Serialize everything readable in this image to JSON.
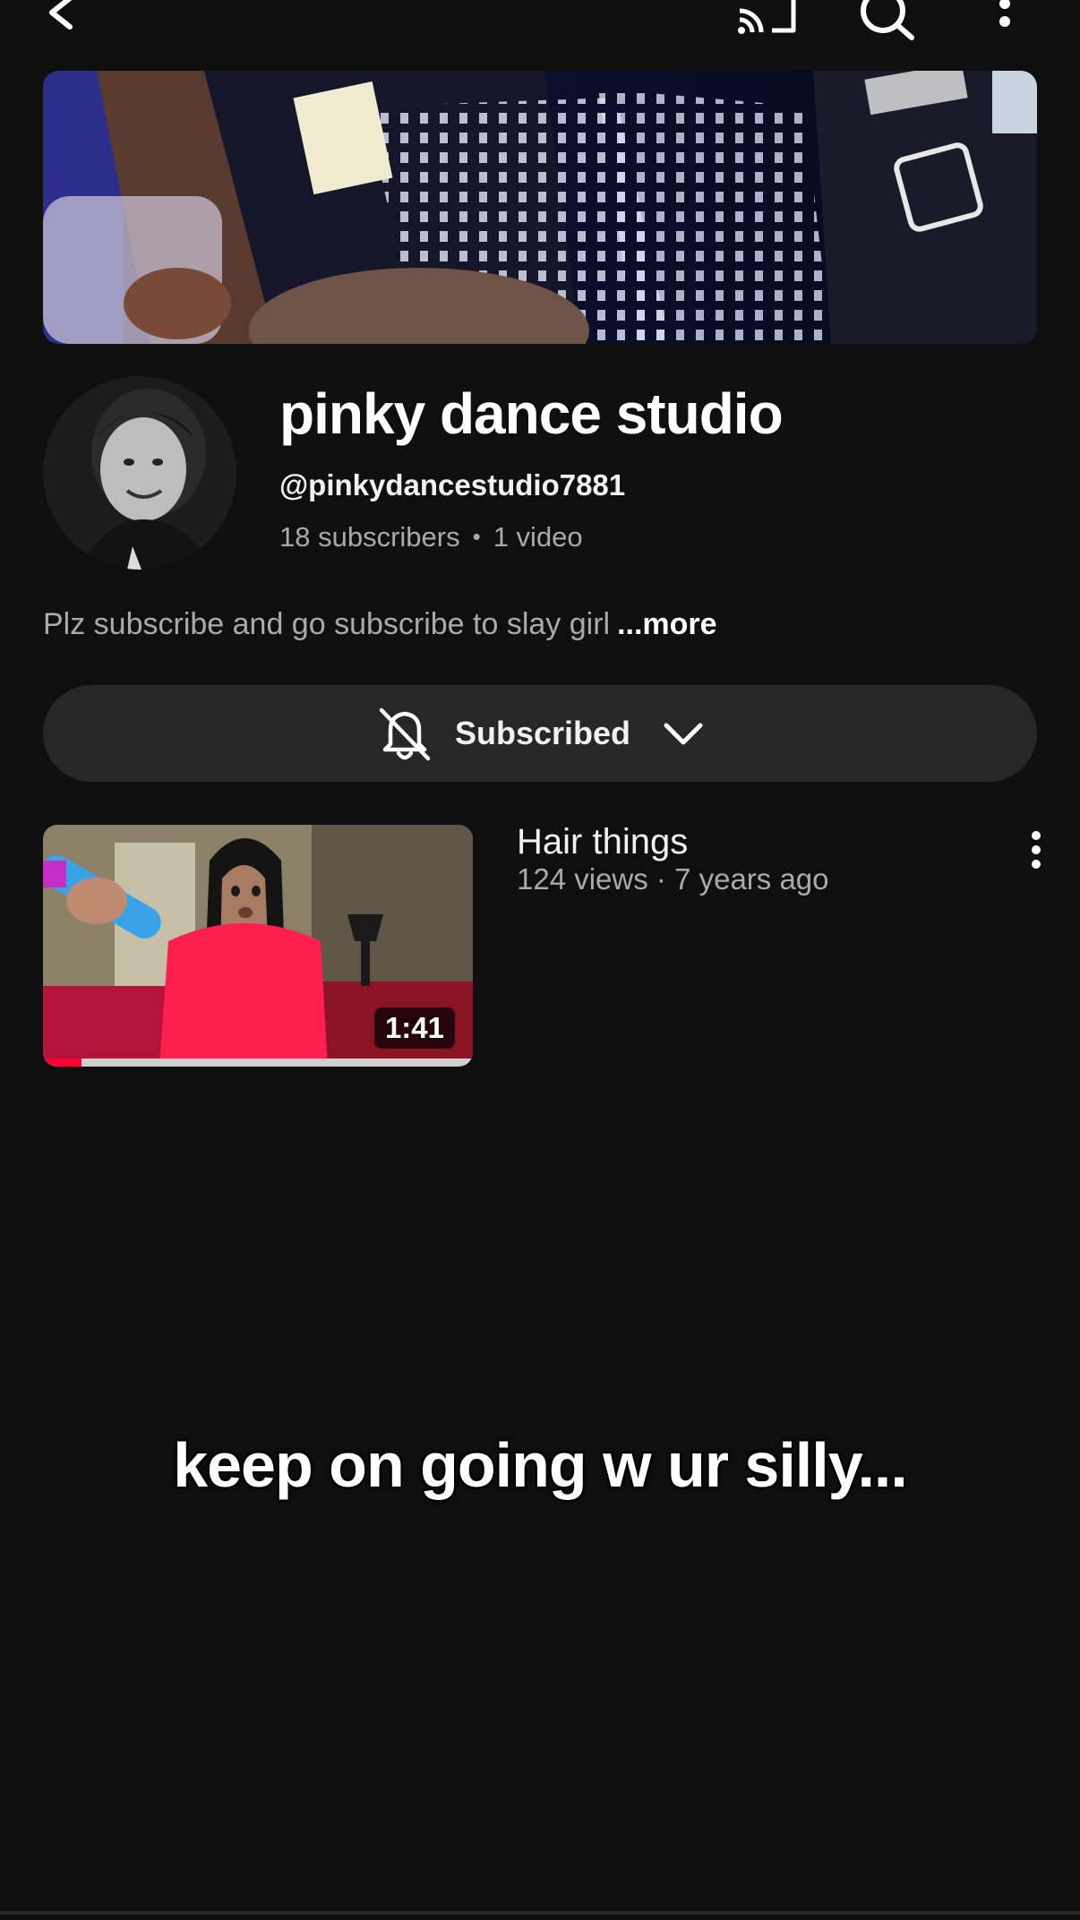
{
  "topbar": {
    "back_icon": "back-arrow-icon",
    "cast_icon": "cast-icon",
    "search_icon": "search-icon",
    "more_icon": "more-vertical-icon"
  },
  "channel": {
    "name": "pinky dance studio",
    "handle": "@pinkydancestudio7881",
    "subscribers": "18 subscribers",
    "separator": "•",
    "video_count": "1 video",
    "description": "Plz subscribe and go subscribe to slay girl",
    "more_label": "...more"
  },
  "subscribe_button": {
    "label": "Subscribed",
    "bell_icon": "bell-off-icon",
    "chevron_icon": "chevron-down-icon"
  },
  "videos": [
    {
      "title": "Hair things",
      "meta": "124 views · 7 years ago",
      "duration": "1:41",
      "watched_progress": 0.09,
      "more_icon": "more-vertical-icon"
    }
  ],
  "overlay": {
    "caption": "keep on going w ur silly..."
  },
  "colors": {
    "background": "#0f0f0f",
    "button_bg": "#272727",
    "secondary_text": "#aaaaaa",
    "progress_red": "#ff0033"
  }
}
